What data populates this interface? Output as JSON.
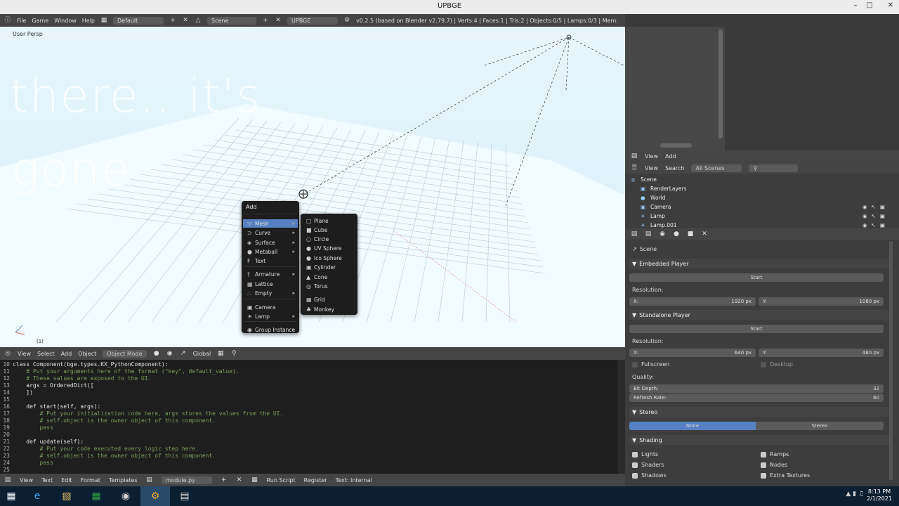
{
  "window": {
    "title": "UPBGE"
  },
  "infobar": {
    "menus": [
      "File",
      "Game",
      "Window",
      "Help"
    ],
    "layout": "Default",
    "scene": "Scene",
    "engine": "UPBGE",
    "status": "v0.2.5 (based on Blender v2.79.7) | Verts:4 | Faces:1 | Tris:2 | Objects:0/5 | Lamps:0/3 | Mem:"
  },
  "viewport": {
    "label": "User Persp",
    "overlay_line1": "there.. it's",
    "overlay_line2": "gone..",
    "frame": "(1)"
  },
  "add_menu": {
    "title": "Add",
    "items": [
      {
        "label": "Mesh",
        "icon": "mesh-icon",
        "sub": true
      },
      {
        "label": "Curve",
        "icon": "curve-icon",
        "sub": true
      },
      {
        "label": "Surface",
        "icon": "surface-icon",
        "sub": true
      },
      {
        "label": "Metaball",
        "icon": "metaball-icon",
        "sub": true
      },
      {
        "label": "Text",
        "icon": "text-icon",
        "sub": false
      },
      {
        "label": "Armature",
        "icon": "armature-icon",
        "sub": true
      },
      {
        "label": "Lattice",
        "icon": "lattice-icon",
        "sub": false
      },
      {
        "label": "Empty",
        "icon": "empty-icon",
        "sub": true
      },
      {
        "label": "Camera",
        "icon": "camera-icon",
        "sub": false
      },
      {
        "label": "Lamp",
        "icon": "lamp-icon",
        "sub": true
      },
      {
        "label": "Group Instance",
        "icon": "group-icon",
        "sub": true
      }
    ]
  },
  "mesh_menu": {
    "items": [
      "Plane",
      "Cube",
      "Circle",
      "UV Sphere",
      "Ico Sphere",
      "Cylinder",
      "Cone",
      "Torus",
      "Grid",
      "Monkey"
    ]
  },
  "view3d_header": {
    "menus": [
      "View",
      "Select",
      "Add",
      "Object"
    ],
    "mode": "Object Mode",
    "orientation": "Global"
  },
  "code": [
    {
      "n": "10",
      "t": "class Component(bge.types.KX_PythonComponent):",
      "c": false
    },
    {
      "n": "11",
      "t": "    # Put your arguments here of the format (\"key\", default_value).",
      "c": true
    },
    {
      "n": "12",
      "t": "    # These values are exposed to the UI.",
      "c": true
    },
    {
      "n": "13",
      "t": "    args = OrderedDict([",
      "c": false
    },
    {
      "n": "14",
      "t": "    ])",
      "c": false
    },
    {
      "n": "15",
      "t": "",
      "c": false
    },
    {
      "n": "16",
      "t": "    def start(self, args):",
      "c": false
    },
    {
      "n": "17",
      "t": "        # Put your initialization code here, args stores the values from the UI.",
      "c": true
    },
    {
      "n": "18",
      "t": "        # self.object is the owner object of this component.",
      "c": true
    },
    {
      "n": "19",
      "t": "        pass",
      "c": true
    },
    {
      "n": "20",
      "t": "",
      "c": false
    },
    {
      "n": "21",
      "t": "    def update(self):",
      "c": false
    },
    {
      "n": "22",
      "t": "        # Put your code executed every logic step here.",
      "c": true
    },
    {
      "n": "23",
      "t": "        # self.object is the owner object of this component.",
      "c": true
    },
    {
      "n": "24",
      "t": "        pass",
      "c": true
    },
    {
      "n": "25",
      "t": "",
      "c": false
    }
  ],
  "text_header": {
    "menus": [
      "View",
      "Text",
      "Edit",
      "Format",
      "Templates"
    ],
    "filename": "module.py",
    "run_script": "Run Script",
    "register": "Register",
    "status": "Text: Internal"
  },
  "outliner": {
    "bar1": [
      "View",
      "Add"
    ],
    "bar2_view": "View",
    "bar2_search": "Search",
    "filter": "All Scenes",
    "tree": [
      {
        "label": "Scene",
        "indent": 0
      },
      {
        "label": "RenderLayers",
        "indent": 1
      },
      {
        "label": "World",
        "indent": 1
      },
      {
        "label": "Camera",
        "indent": 1
      },
      {
        "label": "Lamp",
        "indent": 1
      },
      {
        "label": "Lamp.001",
        "indent": 1
      }
    ]
  },
  "properties": {
    "context": "Scene",
    "embedded": {
      "title": "Embedded Player",
      "start": "Start",
      "resolution": "Resolution:",
      "x_label": "X:",
      "x_val": "1920 px",
      "y_label": "Y:",
      "y_val": "1080 px"
    },
    "standalone": {
      "title": "Standalone Player",
      "start": "Start",
      "resolution": "Resolution:",
      "x_label": "X:",
      "x_val": "640 px",
      "y_label": "Y:",
      "y_val": "480 px",
      "fullscreen": "Fullscreen",
      "desktop": "Desktop",
      "quality": "Quality:",
      "bit_depth_label": "Bit Depth:",
      "bit_depth": "32",
      "refresh_label": "Refresh Rate:",
      "refresh": "60"
    },
    "stereo": {
      "title": "Stereo",
      "none": "None",
      "stereo": "Stereo"
    },
    "shading": {
      "title": "Shading",
      "left": [
        "Lights",
        "Shaders",
        "Shadows"
      ],
      "right": [
        "Ramps",
        "Nodes",
        "Extra Textures"
      ]
    }
  },
  "taskbar": {
    "time": "8:13 PM",
    "date": "2/1/2021"
  },
  "colors": {
    "accent": "#5680c2",
    "viewport_bg": "#d6eef9"
  }
}
